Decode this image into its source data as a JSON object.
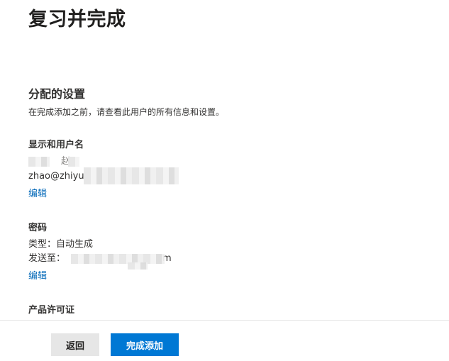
{
  "page": {
    "title": "复习并完成"
  },
  "section": {
    "heading": "分配的设置",
    "description": "在完成添加之前，请查看此用户的所有信息和设置。"
  },
  "display_name_group": {
    "heading": "显示和用户名",
    "display_name": "赵",
    "username": "zhao@zhiyu",
    "edit_label": "编辑"
  },
  "password_group": {
    "heading": "密码",
    "type_line": "类型：自动生成",
    "send_to_prefix": "发送至：",
    "send_to_suffix": "m",
    "edit_label": "编辑"
  },
  "license_group": {
    "heading": "产品许可证"
  },
  "footer": {
    "back_label": "返回",
    "finish_label": "完成添加"
  },
  "colors": {
    "primary": "#0078d4",
    "link": "#0067b8",
    "secondary_button": "#e6e6e6"
  }
}
